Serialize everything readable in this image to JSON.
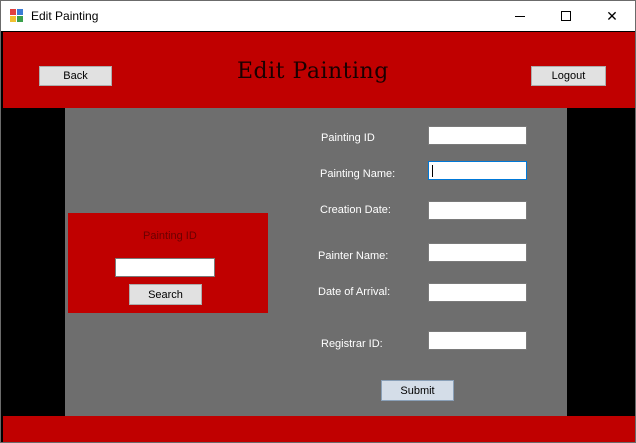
{
  "window": {
    "title": "Edit Painting",
    "controls": {
      "minimize": "minimize",
      "maximize": "maximize",
      "close": "✕"
    }
  },
  "header": {
    "title": "Edit Painting",
    "back_label": "Back",
    "logout_label": "Logout"
  },
  "search": {
    "label": "Painting ID",
    "value": "",
    "button_label": "Search"
  },
  "form": {
    "fields": [
      {
        "label": "Painting ID",
        "value": ""
      },
      {
        "label": "Painting Name:",
        "value": ""
      },
      {
        "label": "Creation Date:",
        "value": ""
      },
      {
        "label": "Painter Name:",
        "value": ""
      },
      {
        "label": "Date of Arrival:",
        "value": ""
      },
      {
        "label": "Registrar ID:",
        "value": ""
      }
    ],
    "submit_label": "Submit"
  },
  "colors": {
    "accent": "#c00000",
    "panel": "#6e6e6e",
    "background": "#000000"
  }
}
